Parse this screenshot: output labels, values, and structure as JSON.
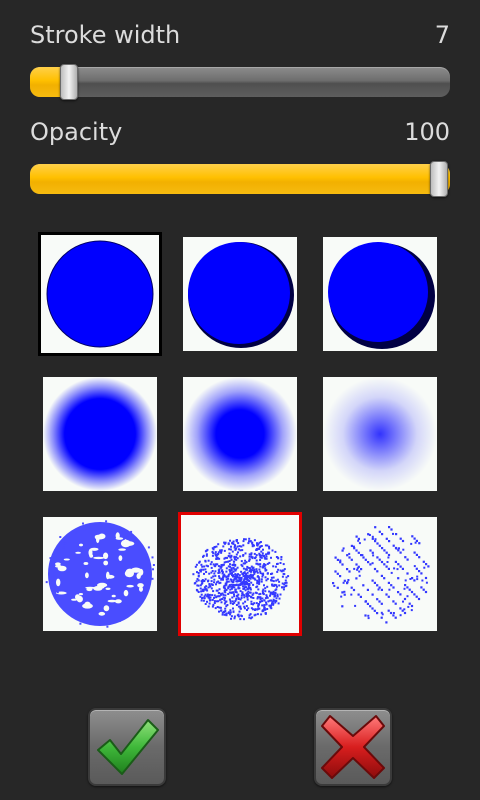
{
  "stroke_width": {
    "label": "Stroke width",
    "value": "7",
    "level": 0.092
  },
  "opacity": {
    "label": "Opacity",
    "value": "100",
    "level": 1.0
  },
  "brushes": [
    {
      "style": "solid-flat",
      "selected": "default"
    },
    {
      "style": "solid-shaded",
      "selected": "none"
    },
    {
      "style": "solid-deep-shaded",
      "selected": "none"
    },
    {
      "style": "soft-edge",
      "selected": "none"
    },
    {
      "style": "softer-edge",
      "selected": "none"
    },
    {
      "style": "airbrush",
      "selected": "none"
    },
    {
      "style": "spatter-blot",
      "selected": "none"
    },
    {
      "style": "spray-dots",
      "selected": "active"
    },
    {
      "style": "crosshatch-dots",
      "selected": "none"
    }
  ],
  "colors": {
    "brush_blue": "#0000ff",
    "slider_fill": "#ffc000",
    "selected_active": "#e00000",
    "selected_default": "#000000",
    "confirm_green": "#3fb83a",
    "cancel_red": "#d81e1e"
  },
  "buttons": {
    "confirm_icon": "checkmark-icon",
    "cancel_icon": "x-icon"
  }
}
